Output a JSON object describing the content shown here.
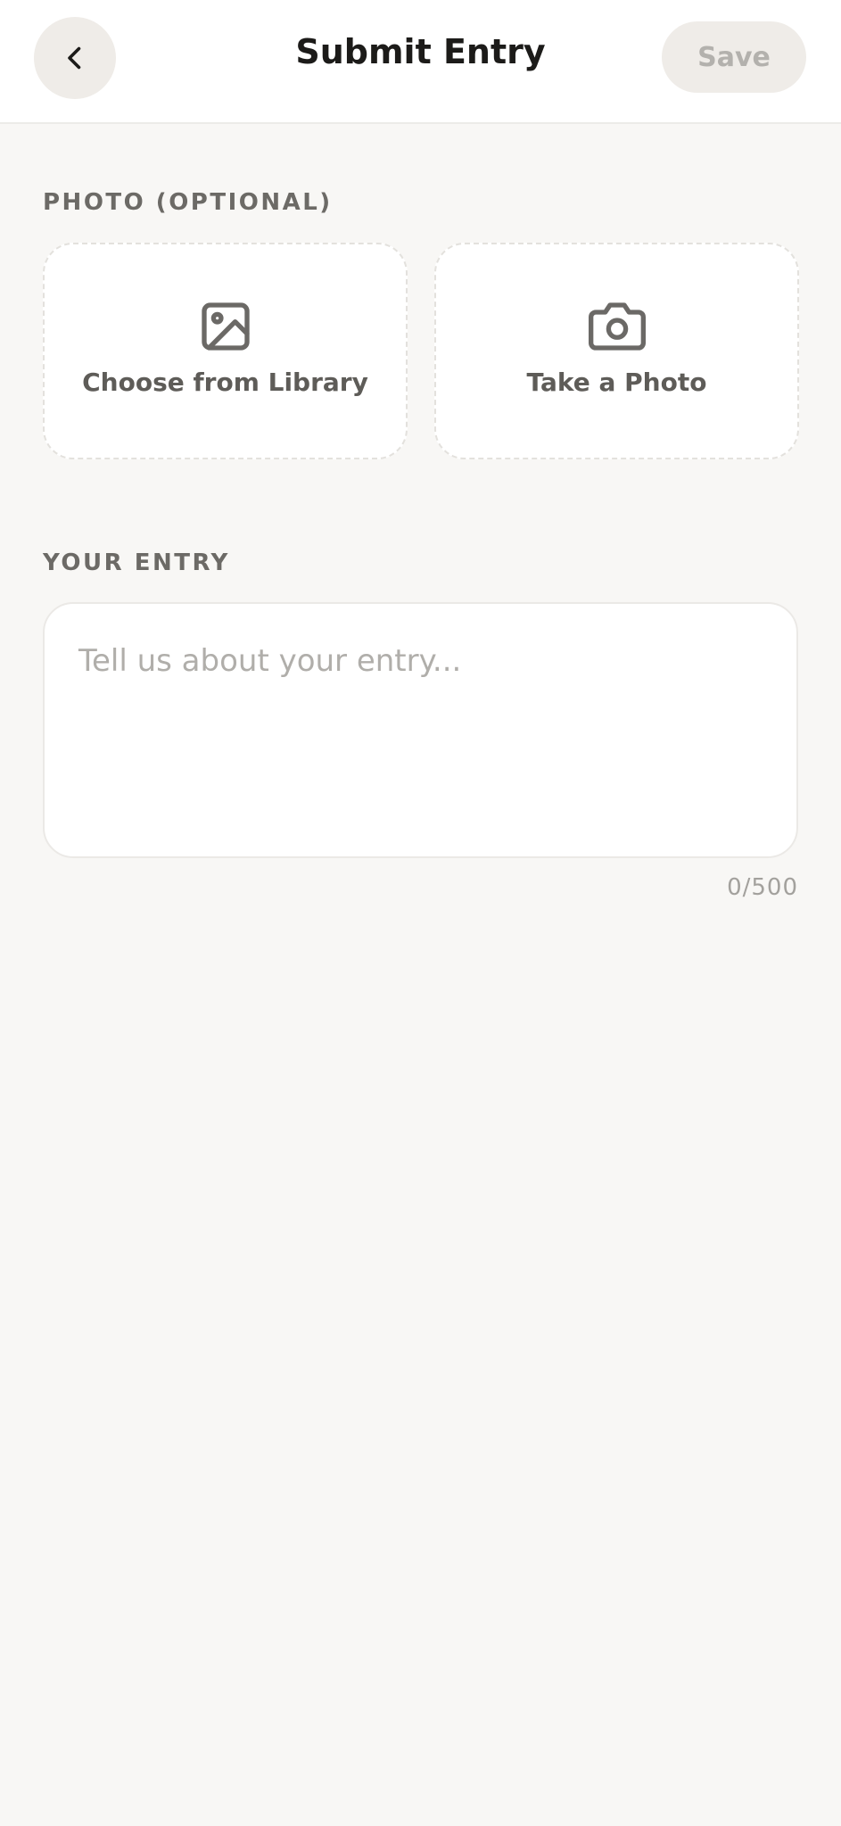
{
  "header": {
    "title": "Submit Entry",
    "save_label": "Save",
    "back_icon": "chevron-left-icon"
  },
  "photo_section": {
    "label": "PHOTO (OPTIONAL)",
    "options": [
      {
        "label": "Choose from Library",
        "icon": "image-icon"
      },
      {
        "label": "Take a Photo",
        "icon": "camera-icon"
      }
    ]
  },
  "entry_section": {
    "label": "YOUR ENTRY",
    "value": "",
    "placeholder": "Tell us about your entry...",
    "char_count": "0/500"
  },
  "colors": {
    "background": "#f8f7f5",
    "surface": "#ffffff",
    "button_bg": "#efece8",
    "save_disabled_text": "#b3b1ad",
    "label_text": "#6c6a66",
    "icon_gray": "#6b6966"
  }
}
